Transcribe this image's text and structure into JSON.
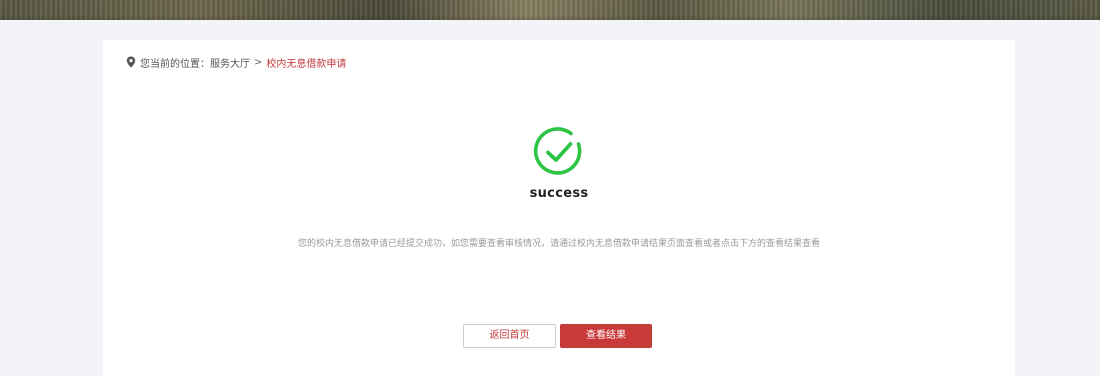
{
  "breadcrumb": {
    "prefix": "您当前的位置：",
    "parent": "服务大厅",
    "separator": ">",
    "current": "校内无息借款申请"
  },
  "result": {
    "title": "success",
    "message": "您的校内无息借款申请已经提交成功，如您需要查看审核情况，请通过校内无息借款申请结果页面查看或者点击下方的查看结果查看"
  },
  "buttons": {
    "home": "返回首页",
    "view_result": "查看结果"
  },
  "colors": {
    "accent": "#c83a3a",
    "success": "#2ec445"
  },
  "icons": {
    "location": "map-pin-icon",
    "success": "check-circle-icon"
  }
}
